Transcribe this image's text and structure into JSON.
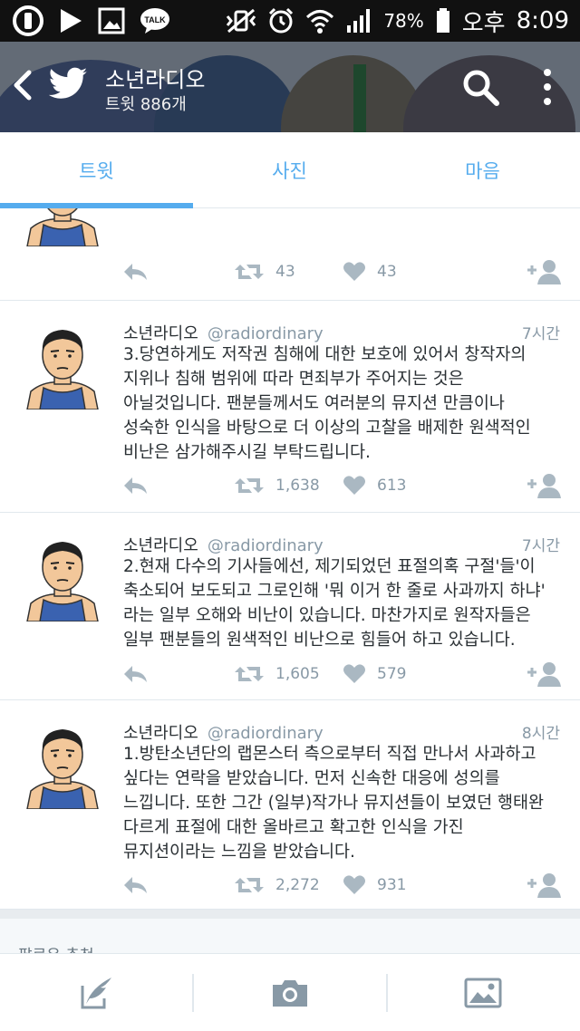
{
  "status_bar": {
    "battery": "78%",
    "ampm": "오후",
    "time": "8:09",
    "left_icons": [
      "u-plus-icon",
      "play-store-icon",
      "gallery-icon",
      "kakaotalk-icon"
    ],
    "right_icons": [
      "vibrate-icon",
      "alarm-icon",
      "wifi-icon",
      "signal-icon",
      "battery-icon"
    ],
    "talk_badge": "TALK"
  },
  "header": {
    "title": "소년라디오",
    "tweet_count": "트윗 886개",
    "bird_color": "#ffffff"
  },
  "tabs": [
    {
      "label": "트윗",
      "active": true
    },
    {
      "label": "사진",
      "active": false
    },
    {
      "label": "마음",
      "active": false
    }
  ],
  "accent_color": "#55acee",
  "tweets": [
    {
      "partial": true,
      "retweets": "43",
      "likes": "43"
    },
    {
      "name": "소년라디오",
      "handle": "@radiordinary",
      "time": "7시간",
      "text": "3.당연하게도 저작권 침해에 대한 보호에 있어서 창작자의\n지위나 침해 범위에 따라 면죄부가 주어지는 것은\n아닐것입니다. 팬분들께서도 여러분의 뮤지션 만큼이나\n성숙한 인식을 바탕으로 더 이상의 고찰을 배제한 원색적인\n비난은 삼가해주시길 부탁드립니다.",
      "retweets": "1,638",
      "likes": "613"
    },
    {
      "name": "소년라디오",
      "handle": "@radiordinary",
      "time": "7시간",
      "text": "2.현재 다수의 기사들에선, 제기되었던 표절의혹 구절'들'이\n축소되어 보도되고 그로인해 '뭐 이거 한 줄로 사과까지 하냐'\n라는 일부 오해와 비난이 있습니다. 마찬가지로 원작자들은\n일부 팬분들의 원색적인 비난으로 힘들어 하고 있습니다.",
      "retweets": "1,605",
      "likes": "579"
    },
    {
      "name": "소년라디오",
      "handle": "@radiordinary",
      "time": "8시간",
      "text": "1.방탄소년단의 랩몬스터 측으로부터 직접 만나서 사과하고\n싶다는 연락을 받았습니다. 먼저 신속한 대응에 성의를\n느낍니다. 또한 그간 (일부)작가나 뮤지션들이 보였던 행태완\n다르게 표절에 대한 올바르고 확고한 인식을 가진\n뮤지션이라는 느낌을 받았습니다.",
      "retweets": "2,272",
      "likes": "931"
    }
  ],
  "suggestions_label": "팔로우 추천",
  "bottom_bar": [
    "compose-tweet-icon",
    "camera-icon",
    "gallery-icon"
  ]
}
